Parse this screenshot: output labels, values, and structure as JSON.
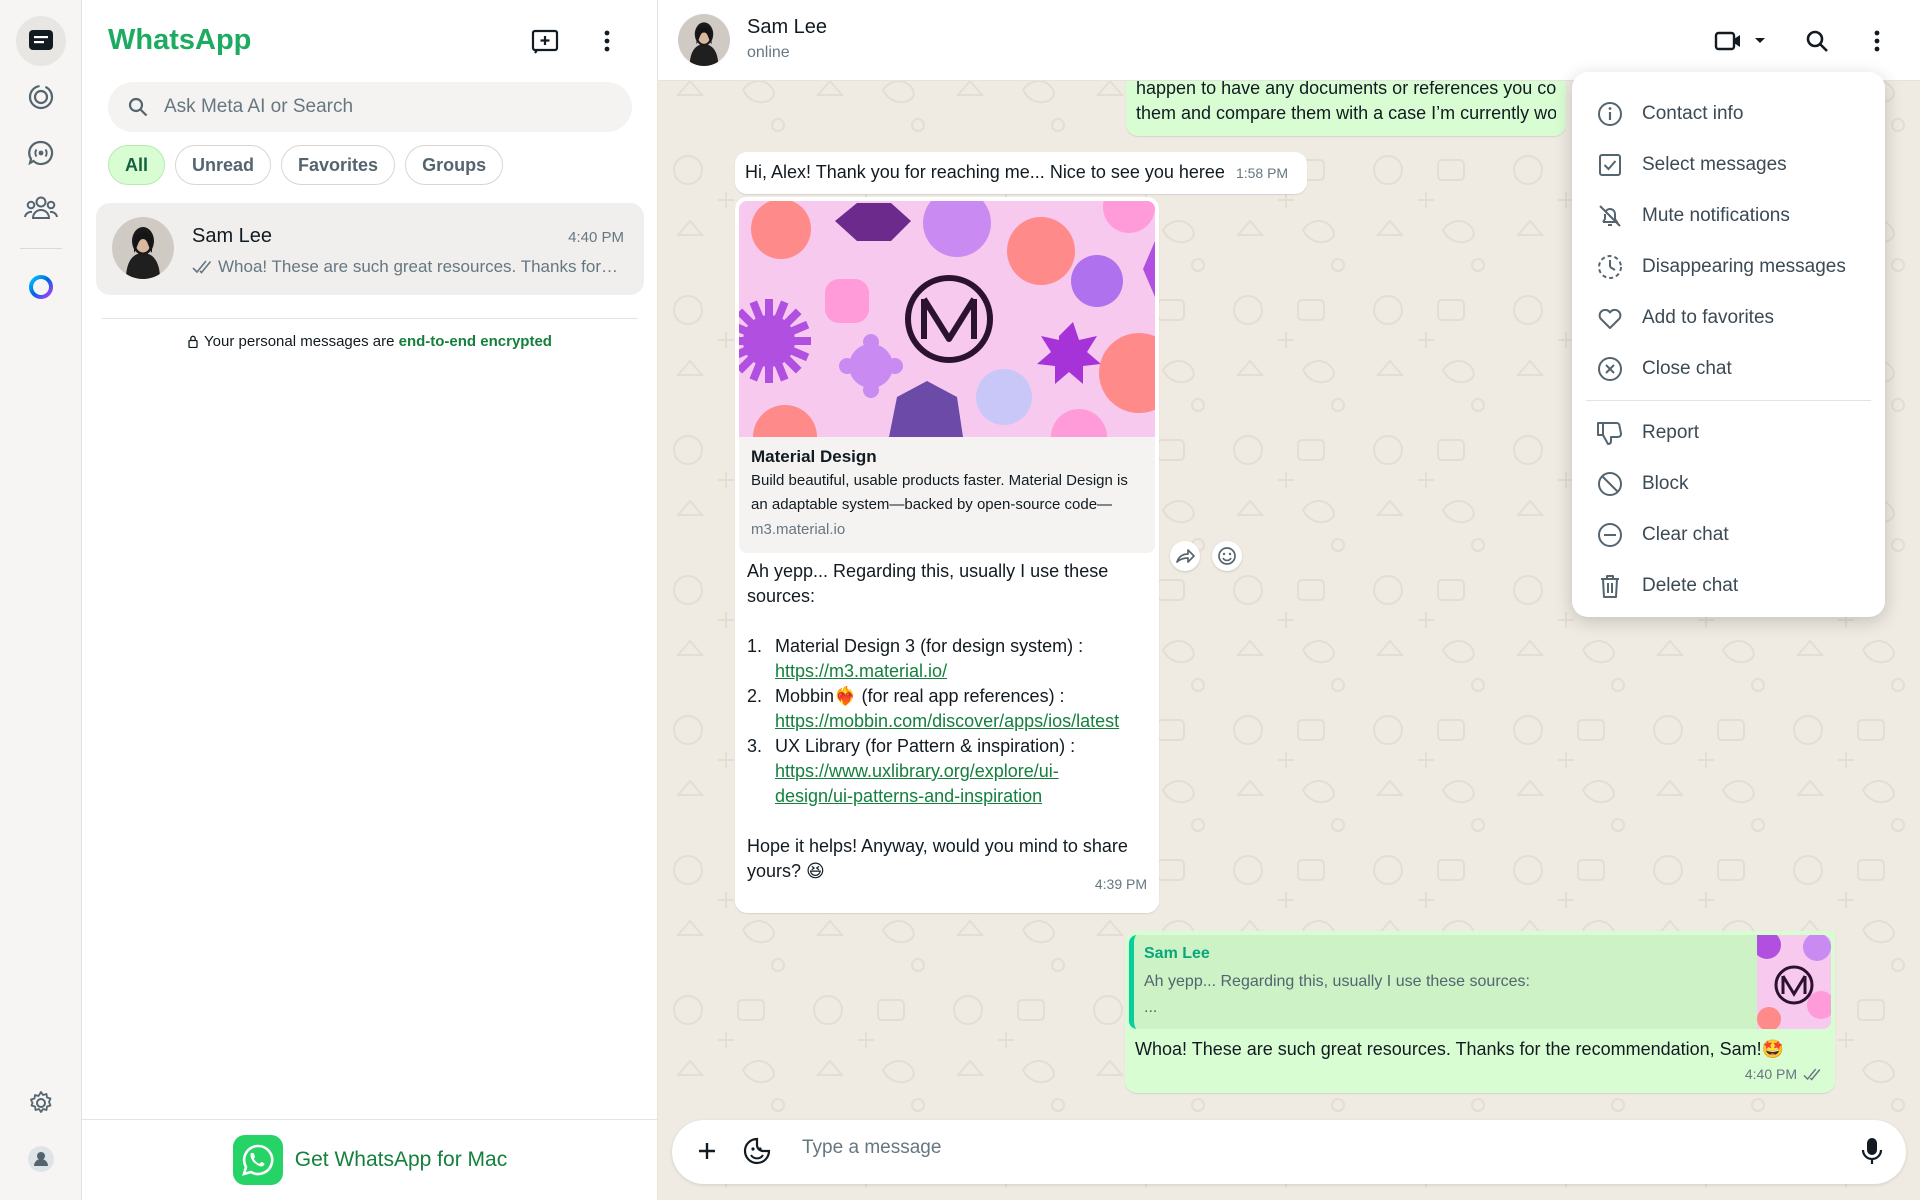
{
  "app": {
    "name": "WhatsApp"
  },
  "search": {
    "placeholder": "Ask Meta AI or Search"
  },
  "filters": [
    {
      "label": "All",
      "active": true
    },
    {
      "label": "Unread",
      "active": false
    },
    {
      "label": "Favorites",
      "active": false
    },
    {
      "label": "Groups",
      "active": false
    }
  ],
  "chat_list": [
    {
      "name": "Sam Lee",
      "time": "4:40 PM",
      "preview": "Whoa! These are such great resources. Thanks for the recommendation, Sam!"
    }
  ],
  "encryption": {
    "text": "Your personal messages are ",
    "link": "end-to-end encrypted"
  },
  "get_mac": {
    "label": "Get WhatsApp for Mac"
  },
  "conversation": {
    "contact_name": "Sam Lee",
    "status": "online",
    "messages": {
      "m0": {
        "line1": "happen to have any documents or references you cou",
        "line2": "them and compare them with a case I’m currently wor"
      },
      "m1": {
        "text": "Hi, Alex! Thank you for reaching me... Nice to see you heree",
        "time": "1:58 PM"
      },
      "m2": {
        "preview_title": "Material Design",
        "preview_desc": "Build beautiful, usable products faster. Material Design is an adaptable system—backed by open-source code—",
        "preview_domain": "m3.material.io",
        "intro": "Ah yepp... Regarding this, usually I use these sources:",
        "items": [
          {
            "num": "1.",
            "text": "Material Design 3 (for design system) :",
            "link": "https://m3.material.io/"
          },
          {
            "num": "2.",
            "text_before": "Mobbin",
            "emoji": "❤️‍🔥",
            "text_after": " (for real app references) :",
            "link": "https://mobbin.com/discover/apps/ios/latest"
          },
          {
            "num": "3.",
            "text": "UX Library (for Pattern & inspiration) :",
            "link1": "https://www.uxlibrary.org/explore/ui-",
            "link2": "design/ui-patterns-and-inspiration"
          }
        ],
        "outro": "Hope it helps! Anyway, would you mind to share yours?",
        "outro_emoji": "😆",
        "time": "4:39 PM"
      },
      "m3": {
        "quote_author": "Sam Lee",
        "quote_text": "Ah yepp... Regarding this, usually I use these sources:",
        "quote_more": "...",
        "text": "Whoa! These are such great resources. Thanks for the recommendation, Sam!",
        "emoji": "🤩",
        "time": "4:40 PM"
      }
    }
  },
  "composer": {
    "placeholder": "Type a message"
  },
  "menu": {
    "items": [
      {
        "label": "Contact info",
        "icon": "info-icon"
      },
      {
        "label": "Select messages",
        "icon": "checkbox-icon"
      },
      {
        "label": "Mute notifications",
        "icon": "bell-off-icon"
      },
      {
        "label": "Disappearing messages",
        "icon": "timer-icon"
      },
      {
        "label": "Add to favorites",
        "icon": "heart-icon"
      },
      {
        "label": "Close chat",
        "icon": "close-circle-icon"
      },
      {
        "label": "Report",
        "icon": "thumbs-down-icon"
      },
      {
        "label": "Block",
        "icon": "block-icon"
      },
      {
        "label": "Clear chat",
        "icon": "minus-circle-icon"
      },
      {
        "label": "Delete chat",
        "icon": "trash-icon"
      }
    ]
  },
  "colors": {
    "brand": "#1daa61",
    "outgoing_bubble": "#d9fdd3",
    "wallpaper": "#efeae2",
    "link": "#15803d"
  }
}
